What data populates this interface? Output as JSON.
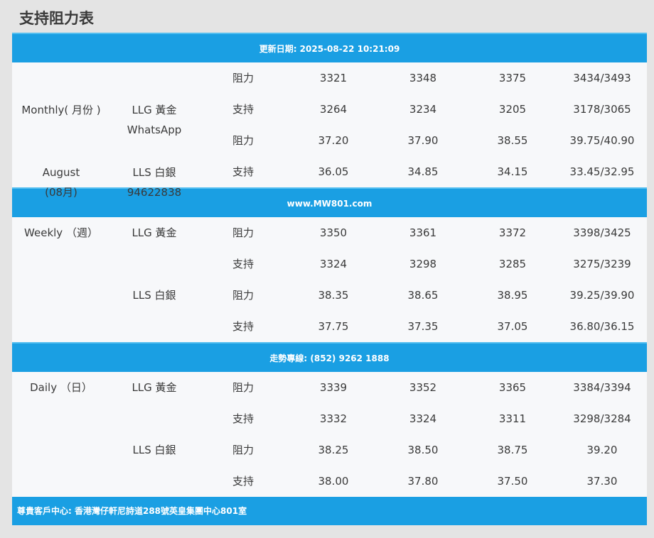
{
  "page_title": "支持阻力表",
  "header_banner": "更新日期: 2025-08-22 10:21:09",
  "website_banner": "www.MW801.com",
  "hotline_banner": "走勢專線: (852) 9262 1888",
  "footer_banner": "尊貴客戶中心: 香港灣仔軒尼詩道288號英皇集團中心801室",
  "monthly": {
    "period": "Monthly( 月份 )",
    "month": "August",
    "month_cn": "(08月)",
    "product_gold": "LLG 黃金",
    "whatsapp_label": "WhatsApp",
    "product_silver": "LLS 白銀",
    "whatsapp_number": "94622838",
    "rows": [
      {
        "type": "阻力",
        "v1": "3321",
        "v2": "3348",
        "v3": "3375",
        "v4": "3434/3493"
      },
      {
        "type": "支持",
        "v1": "3264",
        "v2": "3234",
        "v3": "3205",
        "v4": "3178/3065"
      },
      {
        "type": "阻力",
        "v1": "37.20",
        "v2": "37.90",
        "v3": "38.55",
        "v4": "39.75/40.90"
      },
      {
        "type": "支持",
        "v1": "36.05",
        "v2": "34.85",
        "v3": "34.15",
        "v4": "33.45/32.95"
      }
    ]
  },
  "weekly": {
    "period": "Weekly （週）",
    "product_gold": "LLG 黃金",
    "product_silver": "LLS 白銀",
    "rows": [
      {
        "type": "阻力",
        "v1": "3350",
        "v2": "3361",
        "v3": "3372",
        "v4": "3398/3425"
      },
      {
        "type": "支持",
        "v1": "3324",
        "v2": "3298",
        "v3": "3285",
        "v4": "3275/3239"
      },
      {
        "type": "阻力",
        "v1": "38.35",
        "v2": "38.65",
        "v3": "38.95",
        "v4": "39.25/39.90"
      },
      {
        "type": "支持",
        "v1": "37.75",
        "v2": "37.35",
        "v3": "37.05",
        "v4": "36.80/36.15"
      }
    ]
  },
  "daily": {
    "period": "Daily （日）",
    "product_gold": "LLG 黃金",
    "product_silver": "LLS 白銀",
    "rows": [
      {
        "type": "阻力",
        "v1": "3339",
        "v2": "3352",
        "v3": "3365",
        "v4": "3384/3394"
      },
      {
        "type": "支持",
        "v1": "3332",
        "v2": "3324",
        "v3": "3311",
        "v4": "3298/3284"
      },
      {
        "type": "阻力",
        "v1": "38.25",
        "v2": "38.50",
        "v3": "38.75",
        "v4": "39.20"
      },
      {
        "type": "支持",
        "v1": "38.00",
        "v2": "37.80",
        "v3": "37.50",
        "v4": "37.30"
      }
    ]
  }
}
